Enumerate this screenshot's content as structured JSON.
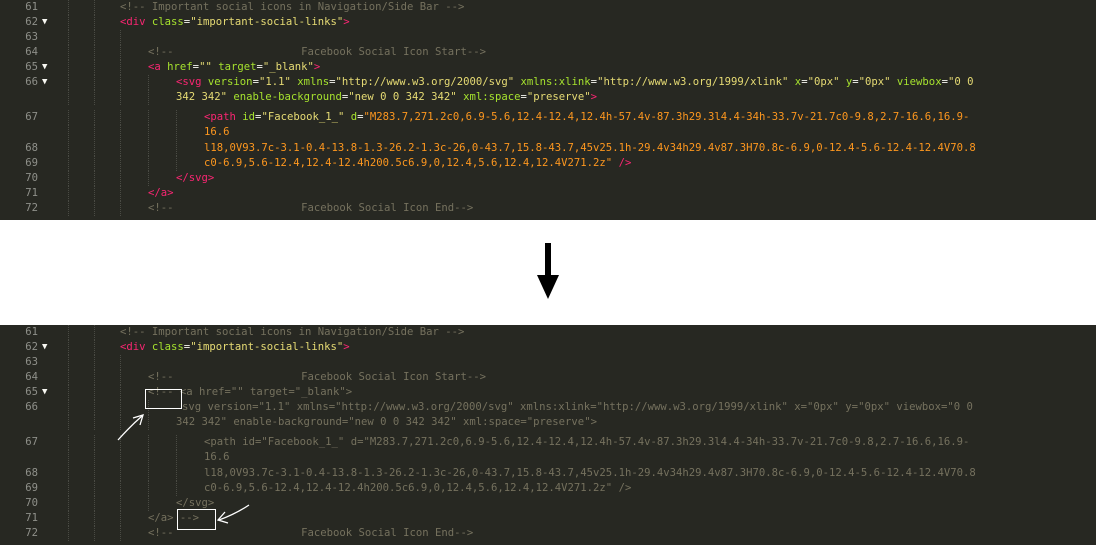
{
  "top_panel": {
    "lines": [
      {
        "n": "61",
        "fold": "",
        "text": "<!-- Important social icons in Navigation/Side Bar -->"
      },
      {
        "n": "62",
        "fold": "▼",
        "text": "<div class=\"important-social-links\">"
      },
      {
        "n": "63",
        "fold": "",
        "text": ""
      },
      {
        "n": "64",
        "fold": "",
        "text": "<!--                    Facebook Social Icon Start-->"
      },
      {
        "n": "65",
        "fold": "▼",
        "text": "<a href=\"\" target=\"_blank\">"
      },
      {
        "n": "66",
        "fold": "▼",
        "text": "<svg version=\"1.1\" xmlns=\"http://www.w3.org/2000/svg\" xmlns:xlink=\"http://www.w3.org/1999/xlink\" x=\"0px\" y=\"0px\" viewbox=\"0 0"
      },
      {
        "n": "",
        "fold": "",
        "text": "342 342\" enable-background=\"new 0 0 342 342\" xml:space=\"preserve\">"
      },
      {
        "n": "67",
        "fold": "",
        "text": "<path id=\"Facebook_1_\" d=\"M283.7,271.2c0,6.9-5.6,12.4-12.4,12.4h-57.4v-87.3h29.3l4.4-34h-33.7v-21.7c0-9.8,2.7-16.6,16.9-"
      },
      {
        "n": "",
        "fold": "",
        "text": "16.6"
      },
      {
        "n": "68",
        "fold": "",
        "text": "l18,0V93.7c-3.1-0.4-13.8-1.3-26.2-1.3c-26,0-43.7,15.8-43.7,45v25.1h-29.4v34h29.4v87.3H70.8c-6.9,0-12.4-5.6-12.4-12.4V70.8"
      },
      {
        "n": "69",
        "fold": "",
        "text": "c0-6.9,5.6-12.4,12.4-12.4h200.5c6.9,0,12.4,5.6,12.4,12.4V271.2z\" />"
      },
      {
        "n": "70",
        "fold": "",
        "text": "</svg>"
      },
      {
        "n": "71",
        "fold": "",
        "text": "</a>"
      },
      {
        "n": "72",
        "fold": "",
        "text": "<!--                    Facebook Social Icon End-->"
      }
    ]
  },
  "bottom_panel": {
    "lines": [
      {
        "n": "61",
        "fold": "",
        "text": "<!-- Important social icons in Navigation/Side Bar -->"
      },
      {
        "n": "62",
        "fold": "▼",
        "text": "<div class=\"important-social-links\">"
      },
      {
        "n": "63",
        "fold": "",
        "text": ""
      },
      {
        "n": "64",
        "fold": "",
        "text": "<!--                    Facebook Social Icon Start-->"
      },
      {
        "n": "65",
        "fold": "▼",
        "text": "<!-- <a href=\"\" target=\"_blank\">"
      },
      {
        "n": "66",
        "fold": "",
        "text": "svg version=\"1.1\" xmlns=\"http://www.w3.org/2000/svg\" xmlns:xlink=\"http://www.w3.org/1999/xlink\" x=\"0px\" y=\"0px\" viewbox=\"0 0"
      },
      {
        "n": "",
        "fold": "",
        "text": "342 342\" enable-background=\"new 0 0 342 342\" xml:space=\"preserve\">"
      },
      {
        "n": "67",
        "fold": "",
        "text": "<path id=\"Facebook_1_\" d=\"M283.7,271.2c0,6.9-5.6,12.4-12.4,12.4h-57.4v-87.3h29.3l4.4-34h-33.7v-21.7c0-9.8,2.7-16.6,16.9-"
      },
      {
        "n": "",
        "fold": "",
        "text": "16.6"
      },
      {
        "n": "68",
        "fold": "",
        "text": "l18,0V93.7c-3.1-0.4-13.8-1.3-26.2-1.3c-26,0-43.7,15.8-43.7,45v25.1h-29.4v34h29.4v87.3H70.8c-6.9,0-12.4-5.6-12.4-12.4V70.8"
      },
      {
        "n": "69",
        "fold": "",
        "text": "c0-6.9,5.6-12.4,12.4-12.4h200.5c6.9,0,12.4,5.6,12.4,12.4V271.2z\" />"
      },
      {
        "n": "70",
        "fold": "",
        "text": "</svg>"
      },
      {
        "n": "71",
        "fold": "",
        "text": "</a> -->"
      },
      {
        "n": "72",
        "fold": "",
        "text": "<!--                    Facebook Social Icon End-->"
      }
    ]
  },
  "icons": {
    "transition": "arrow-down-icon",
    "callout": "hand-drawn-arrow-icon"
  },
  "colors": {
    "editor_bg": "#272822",
    "line_number": "#8f908a",
    "comment": "#75715e",
    "tag": "#f92672",
    "attribute": "#a6e22e",
    "string": "#e6db74",
    "highlight_string": "#fd971f",
    "markup_box": "#ffffff"
  }
}
